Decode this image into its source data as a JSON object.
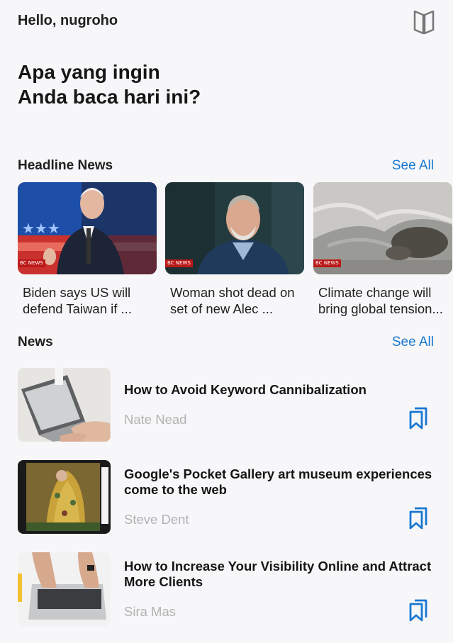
{
  "header": {
    "greeting": "Hello, nugroho",
    "title_line1": "Apa yang ingin",
    "title_line2": "Anda baca hari ini?",
    "top_icon": "book-open-icon"
  },
  "headline_section": {
    "title": "Headline News",
    "see_all": "See All",
    "items": [
      {
        "title": "Biden says US will defend Taiwan if ...",
        "line1": "Biden says US will",
        "line2": "defend Taiwan if ...",
        "badge": "BC NEWS",
        "image": "biden-photo"
      },
      {
        "title": "Woman shot dead on set of new Alec ...",
        "line1": "Woman shot dead on",
        "line2": "set of new Alec ...",
        "badge": "BC NEWS",
        "image": "alec-photo"
      },
      {
        "title": "Climate change will bring global tension...",
        "line1": "Climate change will",
        "line2": "bring global tension...",
        "badge": "BC NEWS",
        "image": "glacier-photo"
      }
    ]
  },
  "news_section": {
    "title": "News",
    "see_all": "See All",
    "items": [
      {
        "title_line1": "How to Avoid Keyword Cannibalization",
        "title_line2": "",
        "author": "Nate Nead",
        "image": "laptop-typing-photo",
        "bookmark_icon": "bookmark-icon"
      },
      {
        "title_line1": "Google's Pocket Gallery art museum experiences",
        "title_line2": "come to the web",
        "author": "Steve Dent",
        "image": "klimt-painting-photo",
        "bookmark_icon": "bookmark-icon"
      },
      {
        "title_line1": "How to Increase Your Visibility Online and Attract",
        "title_line2": "More Clients",
        "author": "Sira Mas",
        "image": "hands-keyboard-photo",
        "bookmark_icon": "bookmark-icon"
      }
    ]
  },
  "colors": {
    "accent": "#1877d1",
    "background": "#f7f7f9",
    "muted_text": "#b3b3b3",
    "badge_red": "#bb1919"
  }
}
